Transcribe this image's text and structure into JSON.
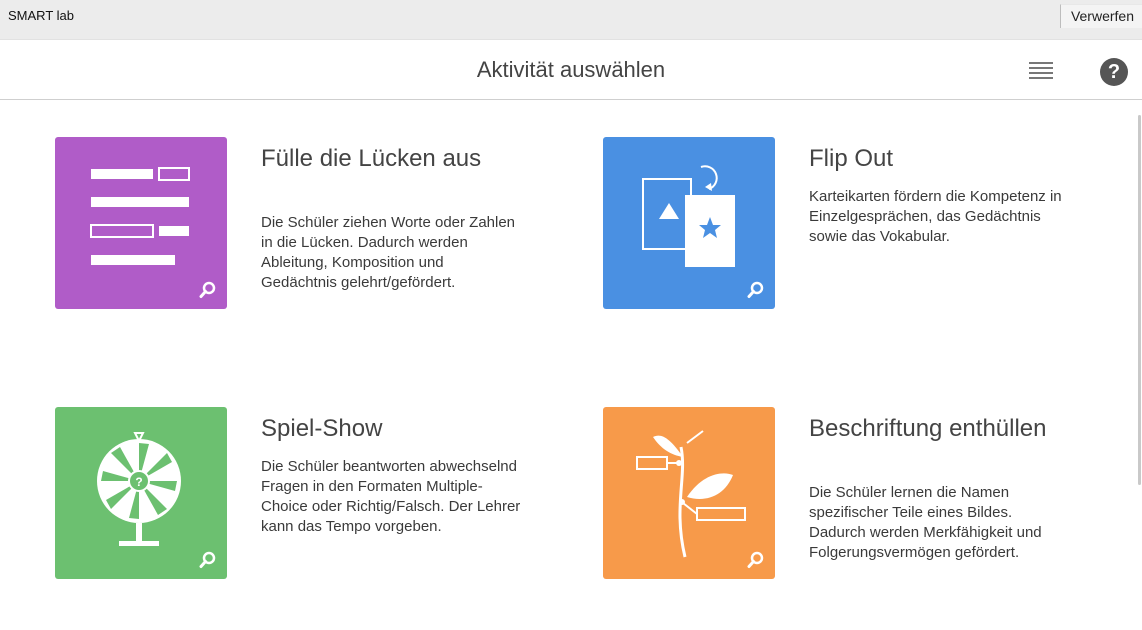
{
  "app": {
    "name": "SMART lab",
    "discard_label": "Verwerfen"
  },
  "header": {
    "title": "Aktivität auswählen",
    "menu_icon": "list-icon",
    "help_icon": "help-icon",
    "help_glyph": "?"
  },
  "activities": [
    {
      "title": "Fülle die Lücken aus",
      "description": "Die Schüler ziehen Worte oder Zahlen in die Lücken. Dadurch werden Ableitung, Komposition und Gedächtnis gelehrt/gefördert.",
      "color": "#b05cc8",
      "icon": "fill-in-blanks-icon"
    },
    {
      "title": "Flip Out",
      "description": "Karteikarten fördern die Kompetenz in Einzelgesprächen, das Gedächtnis sowie das Vokabular.",
      "color": "#4a90e2",
      "icon": "flashcards-icon"
    },
    {
      "title": "Spiel-Show",
      "description": "Die Schüler beantworten abwechselnd Fragen in den Formaten Multiple-Choice oder Richtig/Falsch. Der Lehrer kann das Tempo vorgeben.",
      "color": "#6cc070",
      "icon": "prize-wheel-icon"
    },
    {
      "title": "Beschriftung enthüllen",
      "description": "Die Schüler lernen die Namen spezifischer Teile eines Bildes. Dadurch werden Merkfähigkeit und Folgerungsvermögen gefördert.",
      "color": "#f79a4a",
      "icon": "label-plant-icon"
    }
  ]
}
